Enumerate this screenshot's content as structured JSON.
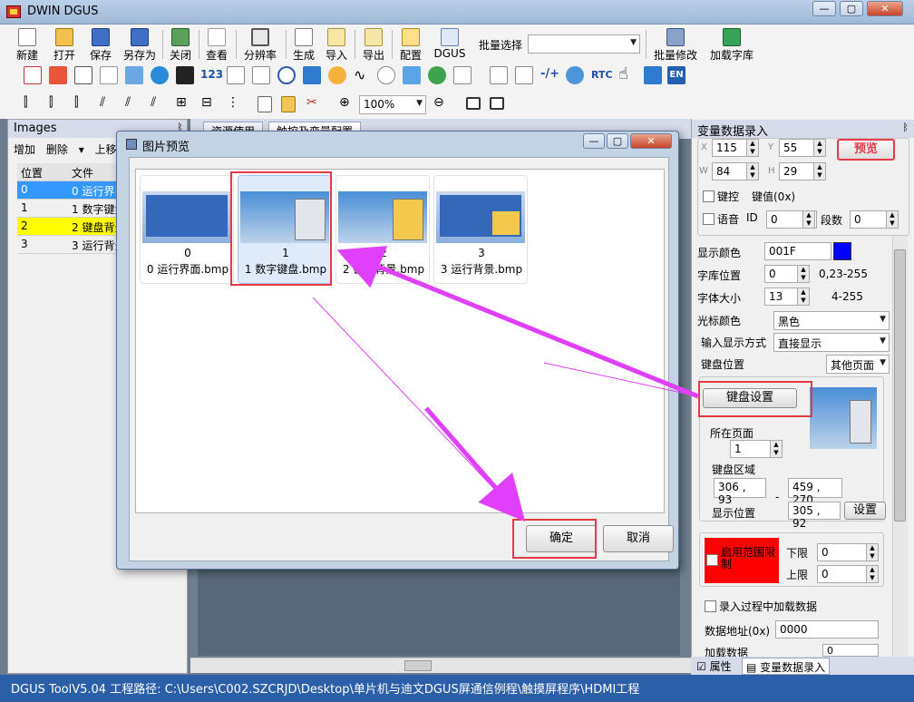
{
  "app": {
    "title": "DWIN DGUS"
  },
  "window_controls": {
    "minimize": "—",
    "maximize": "▢",
    "close": "✕"
  },
  "toolbar": {
    "buttons": [
      "新建",
      "打开",
      "保存",
      "另存为",
      "关闭",
      "查看",
      "分辨率",
      "生成",
      "导入",
      "导出",
      "配置",
      "DGUS"
    ],
    "batch_select_label": "批量选择",
    "batch_select_value": "",
    "batch_modify": "批量修改",
    "load_font": "加载字库",
    "row2_labels": {
      "num": "123",
      "rtc": "RTC",
      "en": "EN",
      "zh": "中"
    },
    "zoom": "100%"
  },
  "images_panel": {
    "title": "Images",
    "pin": "ᛒ",
    "tools": {
      "add": "增加",
      "delete": "删除",
      "move_up": "上移"
    },
    "columns": [
      "位置",
      "文件"
    ],
    "rows": [
      {
        "pos": "0",
        "file": "0 运行界面.bmp",
        "state": "selected"
      },
      {
        "pos": "1",
        "file": "1 数字键盘.bmp",
        "state": "normal"
      },
      {
        "pos": "2",
        "file": "2 键盘背景.bmp",
        "state": "highlight"
      },
      {
        "pos": "3",
        "file": "3 运行背景.bmp",
        "state": "normal"
      }
    ]
  },
  "work_tabs": [
    "资源使用",
    "触控及变量配置"
  ],
  "dialog": {
    "title": "图片预览",
    "thumbnails": [
      {
        "index": "0",
        "name": "0 运行界面.bmp",
        "style": "ui",
        "selected": false,
        "keypad": ""
      },
      {
        "index": "1",
        "name": "1 数字键盘.bmp",
        "style": "keypad",
        "selected": true,
        "keypad": "white"
      },
      {
        "index": "2",
        "name": "2 键盘背景.bmp",
        "style": "keypad",
        "selected": false,
        "keypad": "yellow"
      },
      {
        "index": "3",
        "name": "3 运行背景.bmp",
        "style": "ui",
        "selected": false,
        "keypad": ""
      }
    ],
    "ok": "确定",
    "cancel": "取消"
  },
  "properties": {
    "header": "变量数据录入",
    "pin": "ᛒ",
    "x_label": "X",
    "x_value": "115",
    "y_label": "Y",
    "y_value": "55",
    "w_label": "W",
    "w_value": "84",
    "h_label": "H",
    "h_value": "29",
    "preview_btn": "预览",
    "key_control": "键控",
    "key_value_label": "键值(0x)",
    "voice": "语音",
    "id_label": "ID",
    "id_value": "0",
    "segment_label": "段数",
    "segment_value": "0",
    "display_color_label": "显示颜色",
    "display_color_value": "001F",
    "display_color_hex": "#0000ff",
    "font_pos_label": "字库位置",
    "font_pos_value": "0",
    "font_pos_range": "0,23-255",
    "font_size_label": "字体大小",
    "font_size_value": "13",
    "font_size_range": "4-255",
    "cursor_color_label": "光标颜色",
    "cursor_color_value": "黑色",
    "input_display_label": "输入显示方式",
    "input_display_value": "直接显示",
    "keyboard_pos_label": "键盘位置",
    "keyboard_pos_value": "其他页面",
    "keyboard_setup_btn": "键盘设置",
    "page_label": "所在页面",
    "page_value": "1",
    "keyboard_area_label": "键盘区域",
    "area_from": "306 , 93",
    "area_to": "459 , 270",
    "display_pos_label": "显示位置",
    "display_pos_value": "305 , 92",
    "setup_btn": "设置",
    "dash": "-",
    "range_enable": "启用范围限制",
    "lower_label": "下限",
    "lower_value": "0",
    "upper_label": "上限",
    "upper_value": "0",
    "load_during_input": "录入过程中加载数据",
    "data_addr_label": "数据地址(0x)",
    "data_addr_value": "0000",
    "load_data_label": "加载数据",
    "load_data_value": "0"
  },
  "bottom_tabs": {
    "props": "属性",
    "var_input": "变量数据录入"
  },
  "status": "DGUS ToolV5.04  工程路径: C:\\Users\\C002.SZCRJD\\Desktop\\单片机与迪文DGUS屏通信例程\\触摸屏程序\\HDMI工程",
  "colors": {
    "selected_row": "#3399ff",
    "highlight_row": "#ffff00",
    "annotation_red": "#e63946",
    "annotation_arrow": "#e040fb",
    "status_bar": "#2b5fa8",
    "range_box": "#ff0000"
  }
}
